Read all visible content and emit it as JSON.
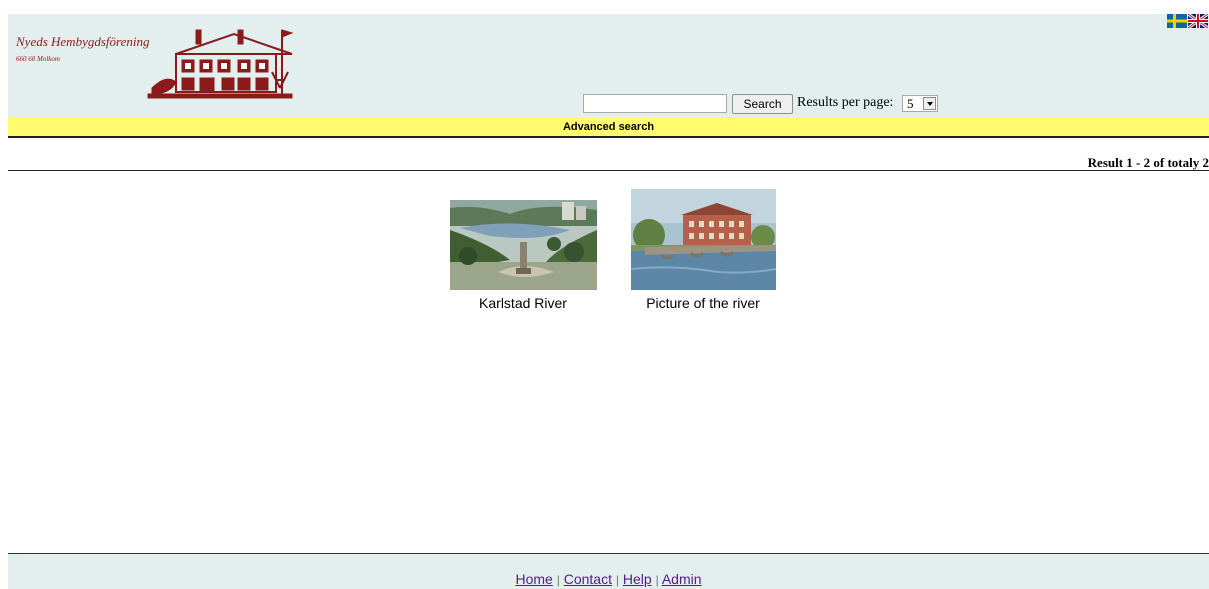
{
  "header": {
    "site_name": "Nyeds Hembygdsförening",
    "site_address": "660 60 Molkom",
    "languages": [
      {
        "name": "swedish-flag-icon",
        "colors": [
          "#006aa7",
          "#fecc00"
        ]
      },
      {
        "name": "uk-flag-icon",
        "colors": [
          "#012169",
          "#ffffff",
          "#c8102e"
        ]
      }
    ]
  },
  "search": {
    "query": "",
    "placeholder": "",
    "button_label": "Search",
    "rpp_label": "Results per page:",
    "rpp_value": "5"
  },
  "advanced_search_label": "Advanced search",
  "results": {
    "count_label": "Result 1 - 2 of totaly 2",
    "items": [
      {
        "caption": "Karlstad River"
      },
      {
        "caption": "Picture of the river"
      }
    ]
  },
  "footer": {
    "links": [
      "Home",
      "Contact",
      "Help",
      "Admin"
    ],
    "separator": "|"
  },
  "colors": {
    "header_bg": "#e3efee",
    "advanced_bar_bg": "#fffa6e",
    "logo_red": "#8b1a1a",
    "link_visited": "#551a8b"
  }
}
